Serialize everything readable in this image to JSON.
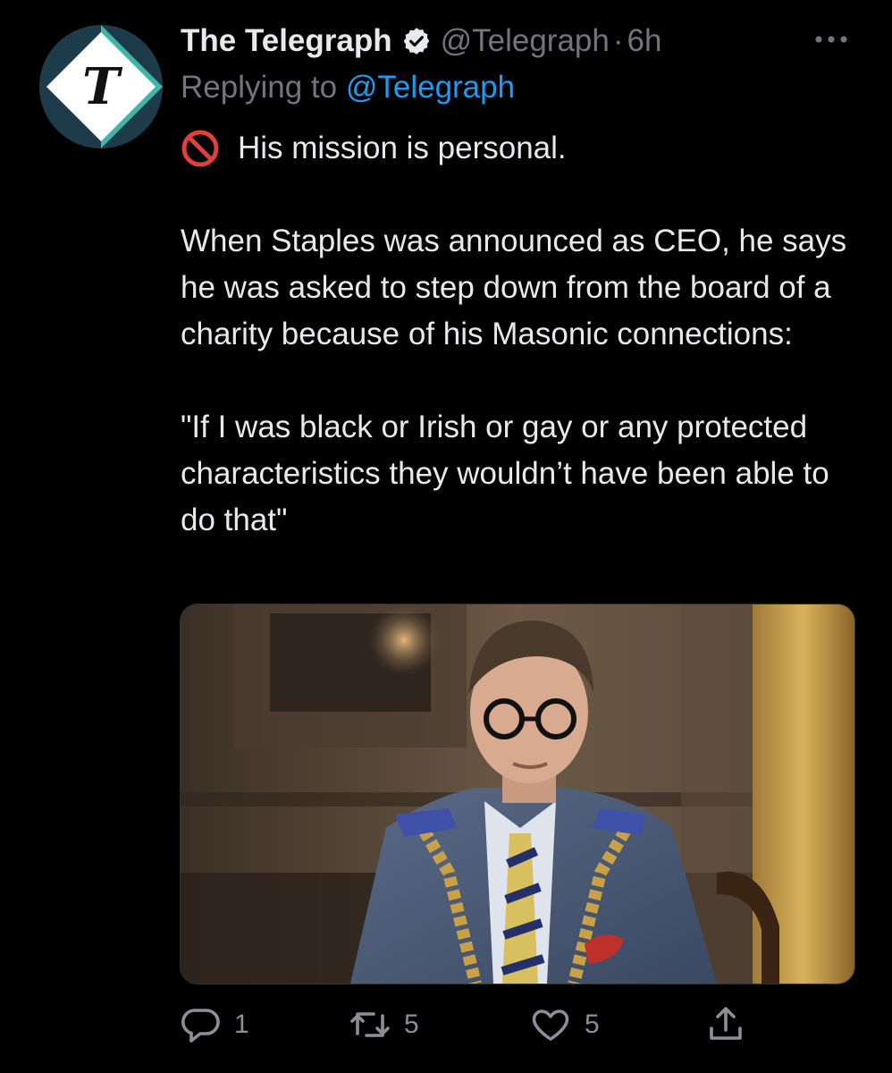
{
  "tweet": {
    "display_name": "The Telegraph",
    "verified": true,
    "handle": "@Telegraph",
    "separator": "·",
    "time": "6h",
    "replying_prefix": "Replying to ",
    "replying_to": "@Telegraph",
    "text_line1": "His mission is personal.",
    "text_para2": "When Staples was announced as CEO, he says he was asked to step down from the board of a charity because of his Masonic connections:",
    "text_para3": "\"If I was black or Irish or gay or any protected characteristics they wouldn’t have been able to do that\"",
    "icons": {
      "avatar": "telegraph-logo",
      "verified": "verified-badge-icon",
      "more": "more-icon",
      "emoji": "no-entry-sign-icon"
    }
  },
  "actions": {
    "reply_count": "1",
    "retweet_count": "5",
    "like_count": "5"
  },
  "colors": {
    "background": "#000000",
    "text": "#e7e9ea",
    "secondary": "#71767b",
    "link": "#1d9bf0",
    "avatar_teal": "#3fb6a8",
    "avatar_navy": "#1d3b4a"
  }
}
